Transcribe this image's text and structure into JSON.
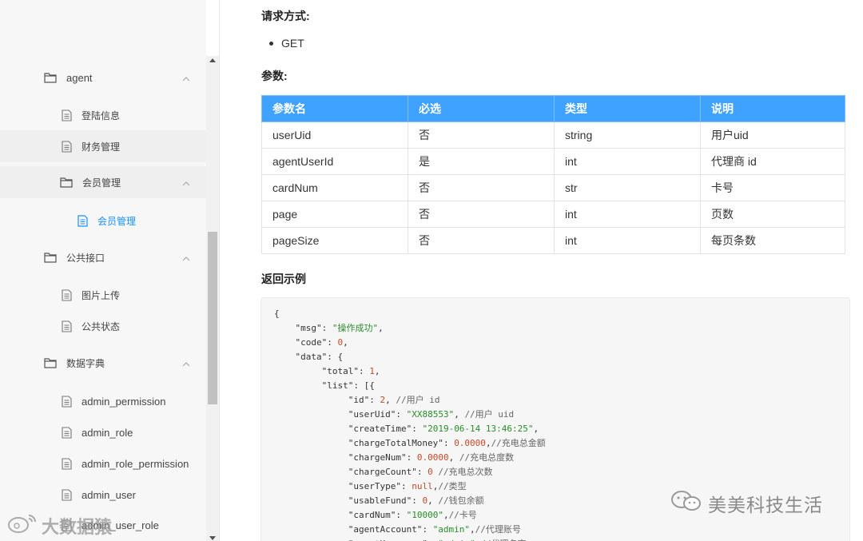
{
  "sidebar": {
    "groups": [
      {
        "label": "agent"
      },
      {
        "label": "会员管理"
      },
      {
        "label": "公共接口"
      },
      {
        "label": "数据字典"
      }
    ],
    "items": [
      {
        "label": "登陆信息"
      },
      {
        "label": "财务管理"
      },
      {
        "label": "会员管理"
      },
      {
        "label": "图片上传"
      },
      {
        "label": "公共状态"
      },
      {
        "label": "admin_permission"
      },
      {
        "label": "admin_role"
      },
      {
        "label": "admin_role_permission"
      },
      {
        "label": "admin_user"
      },
      {
        "label": "admin_user_role"
      }
    ],
    "accent_color": "#1890ff"
  },
  "main": {
    "request_method_label": "请求方式:",
    "method": "GET",
    "params_label": "参数:",
    "table": {
      "headers": [
        "参数名",
        "必选",
        "类型",
        "说明"
      ],
      "rows": [
        [
          "userUid",
          "否",
          "string",
          "用户uid"
        ],
        [
          "agentUserId",
          "是",
          "int",
          "代理商 id"
        ],
        [
          "cardNum",
          "否",
          "str",
          "卡号"
        ],
        [
          "page",
          "否",
          "int",
          "页数"
        ],
        [
          "pageSize",
          "否",
          "int",
          "每页条数"
        ]
      ],
      "header_color": "#3fa2ff"
    },
    "return_label": "返回示例",
    "code_lines": [
      "{",
      "    \"msg\": \"操作成功\",",
      "    \"code\": 0,",
      "    \"data\": {",
      "         \"total\": 1,",
      "         \"list\": [{",
      "              \"id\": 2, //用户 id",
      "              \"userUid\": \"XX88553\", //用户 uid",
      "              \"createTime\": \"2019-06-14 13:46:25\",",
      "              \"chargeTotalMoney\": 0.0000,//充电总金额",
      "              \"chargeNum\": 0.0000, //充电总度数",
      "              \"chargeCount\": 0 //充电总次数",
      "              \"userType\": null,//类型",
      "              \"usableFund\": 0, //钱包余额",
      "              \"cardNum\": \"10000\",//卡号",
      "              \"agentAccount\": \"admin\",//代理账号",
      "              \"agentUsername\": \"admin\" //代理名字"
    ]
  },
  "watermarks": {
    "right": "美美科技生活",
    "left": "大数据猿"
  }
}
